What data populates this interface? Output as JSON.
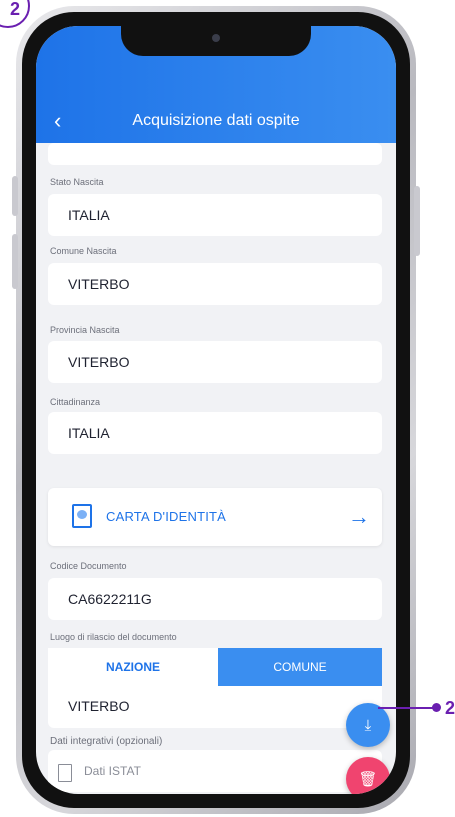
{
  "callout": {
    "step_top": "2",
    "step_side": "2"
  },
  "header": {
    "title": "Acquisizione dati ospite",
    "back_icon": "chevron-left-icon"
  },
  "fields": [
    {
      "label": "Stato Nascita",
      "value": "ITALIA"
    },
    {
      "label": "Comune Nascita",
      "value": "VITERBO"
    },
    {
      "label": "Provincia Nascita",
      "value": "VITERBO"
    },
    {
      "label": "Cittadinanza",
      "value": "ITALIA"
    }
  ],
  "document_type": {
    "label": "CARTA D'IDENTITÀ",
    "icon": "id-card-icon",
    "arrow_icon": "arrow-right-icon"
  },
  "document_code": {
    "label": "Codice Documento",
    "value": "CA6622211G"
  },
  "issue_place": {
    "label": "Luogo di rilascio del documento",
    "tabs": [
      "NAZIONE",
      "COMUNE"
    ],
    "selected": "COMUNE",
    "value": "VITERBO"
  },
  "istat": {
    "label": "Dati integrativi (opzionali)",
    "button_label": "Dati ISTAT"
  },
  "fabs": {
    "download_icon": "download-icon",
    "delete_icon": "trash-icon"
  },
  "colors": {
    "accent": "#1e73e8",
    "header": "#3a8ef0",
    "delete": "#f0446f",
    "callout": "#6a1fb0"
  }
}
